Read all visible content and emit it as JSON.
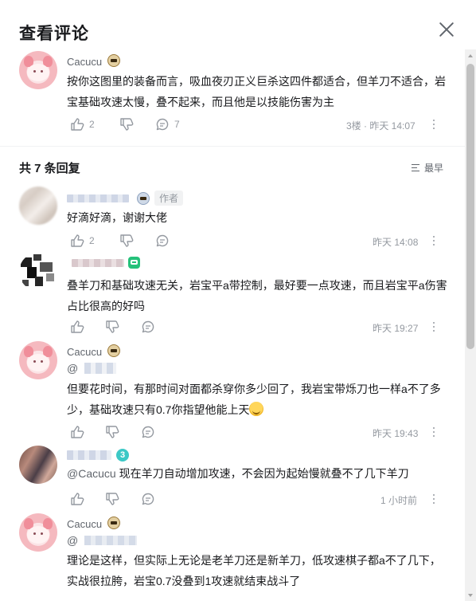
{
  "dialog": {
    "title": "查看评论"
  },
  "root_comment": {
    "username": "Cacucu",
    "content": "按你这图里的装备而言，吸血夜刃正义巨杀这四件都适合，但羊刀不适合，岩宝基础攻速太慢，叠不起来，而且他是以技能伤害为主",
    "likes": "2",
    "replies": "7",
    "floor_time": "3楼 · 昨天 14:07"
  },
  "replies_section": {
    "count_label": "共 7 条回复",
    "sort_label": "最早"
  },
  "replies": [
    {
      "author_tag": "作者",
      "content": "好滴好滴，谢谢大佬",
      "likes": "2",
      "time": "昨天 14:08"
    },
    {
      "content": "叠羊刀和基础攻速无关，岩宝平a带控制，最好要一点攻速，而且岩宝平a伤害占比很高的好吗",
      "time": "昨天 19:27"
    },
    {
      "username": "Cacucu",
      "mention": "@",
      "content": "但要花时间，有那时间对面都杀穿你多少回了，我岩宝带烁刀也一样a不了多少，基础攻速只有0.7你指望他能上天",
      "time": "昨天 19:43"
    },
    {
      "badge_text": "3",
      "mention": "@Cacucu",
      "content": "现在羊刀自动增加攻速，不会因为起始慢就叠不了几下羊刀",
      "time": "1 小时前"
    },
    {
      "username": "Cacucu",
      "mention": "@",
      "content": "理论是这样，但实际上无论是老羊刀还是新羊刀，低攻速棋子都a不了几下，实战很拉胯，岩宝0.7没叠到1攻速就结束战斗了"
    }
  ],
  "icons": {
    "like": "thumbs-up-icon",
    "dislike": "thumbs-down-icon",
    "reply": "reply-bubble-icon",
    "more": "more-vertical-icon",
    "close": "close-icon",
    "sort": "sort-icon"
  },
  "colors": {
    "text": "#18191c",
    "muted": "#9499a0",
    "icon": "#9499a0"
  }
}
